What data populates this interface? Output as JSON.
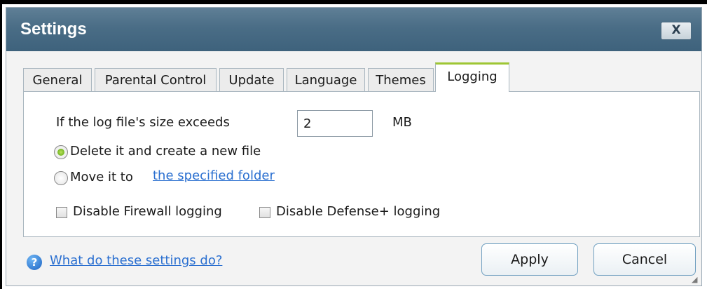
{
  "window": {
    "title": "Settings",
    "close_label": "X"
  },
  "tabs": [
    {
      "label": "General",
      "active": false
    },
    {
      "label": "Parental Control",
      "active": false
    },
    {
      "label": "Update",
      "active": false
    },
    {
      "label": "Language",
      "active": false
    },
    {
      "label": "Themes",
      "active": false
    },
    {
      "label": "Logging",
      "active": true
    }
  ],
  "logging": {
    "size_label": "If the log file's size exceeds",
    "size_value": "2",
    "size_unit": "MB",
    "option_delete": {
      "label": "Delete it and create a new file",
      "selected": true
    },
    "option_move": {
      "label": "Move it to",
      "link": "the specified folder",
      "selected": false
    },
    "disable_firewall": {
      "label": "Disable Firewall logging",
      "checked": false
    },
    "disable_defense": {
      "label": "Disable Defense+ logging",
      "checked": false
    }
  },
  "footer": {
    "help_link": "What do these settings do?",
    "apply_label": "Apply",
    "cancel_label": "Cancel"
  },
  "colors": {
    "titlebar": "#4a6d86",
    "active_tab_accent": "#9ec634",
    "link": "#2a6fd0",
    "radio_selected": "#58a40e"
  }
}
